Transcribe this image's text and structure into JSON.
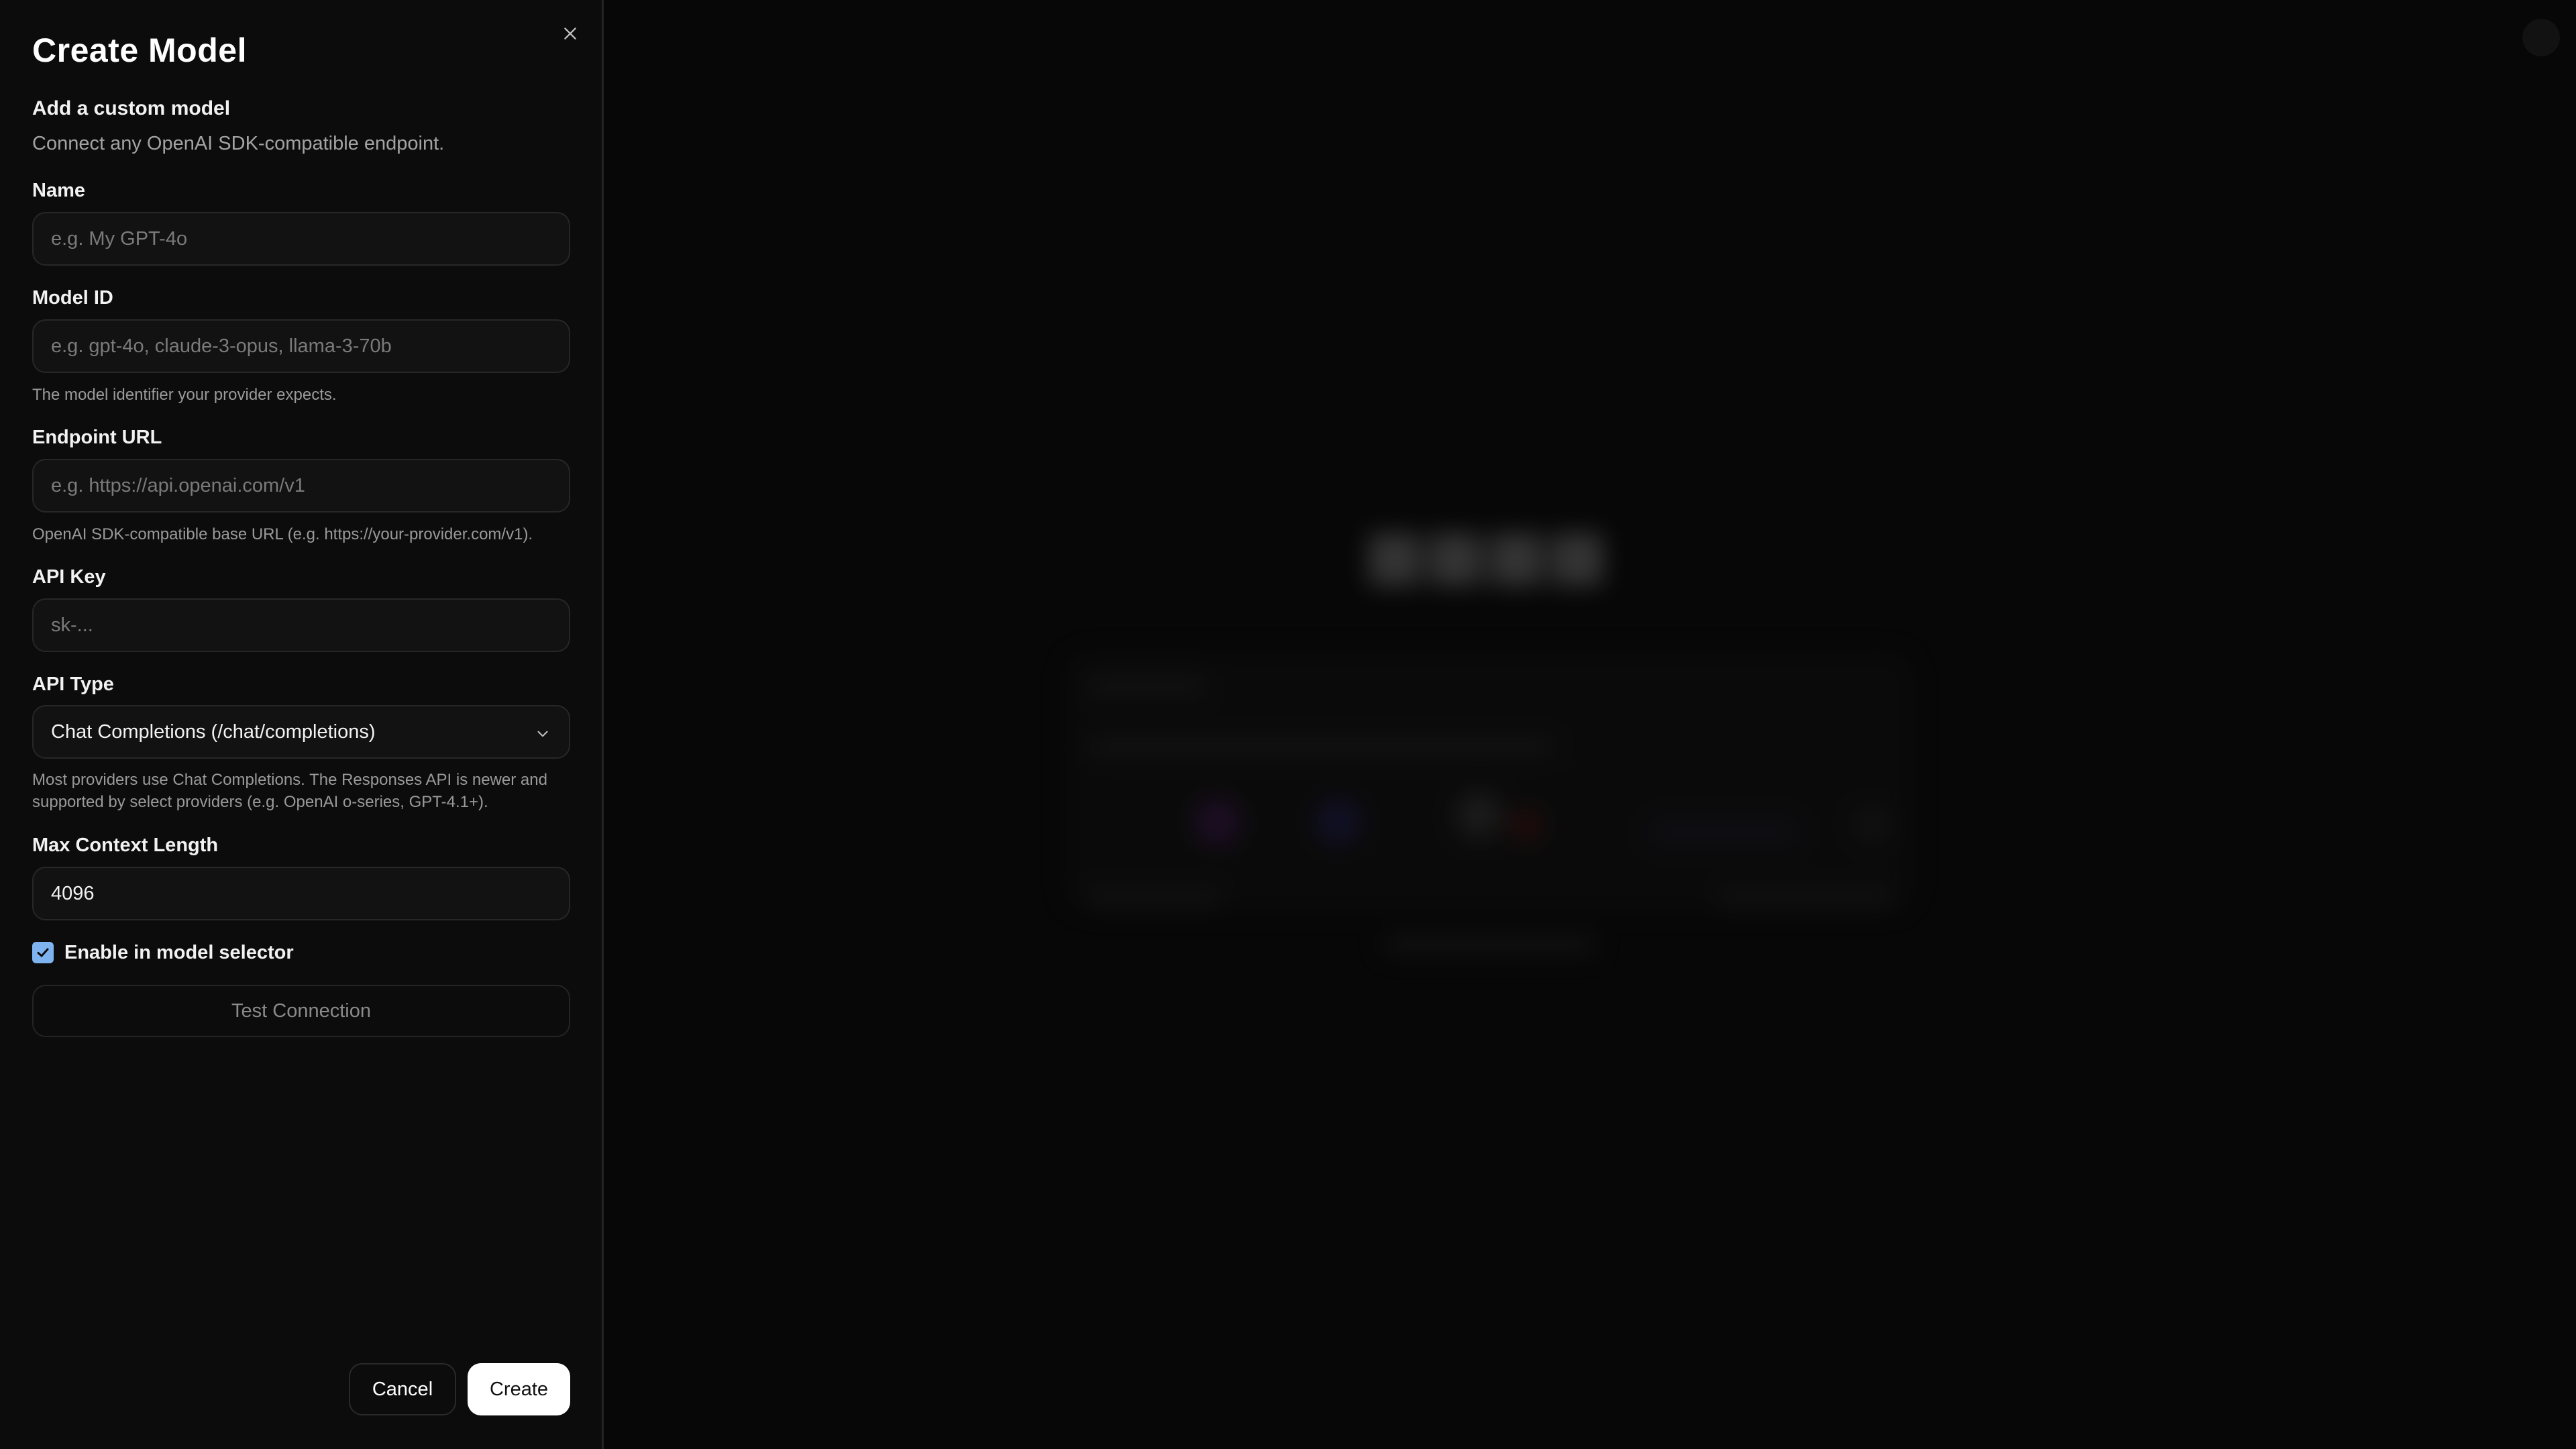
{
  "dialog": {
    "title": "Create Model",
    "subtitle": "Add a custom model",
    "description": "Connect any OpenAI SDK-compatible endpoint."
  },
  "fields": {
    "name": {
      "label": "Name",
      "placeholder": "e.g. My GPT-4o",
      "value": ""
    },
    "model_id": {
      "label": "Model ID",
      "placeholder": "e.g. gpt-4o, claude-3-opus, llama-3-70b",
      "value": "",
      "hint": "The model identifier your provider expects."
    },
    "endpoint_url": {
      "label": "Endpoint URL",
      "placeholder": "e.g. https://api.openai.com/v1",
      "value": "",
      "hint": "OpenAI SDK-compatible base URL (e.g. https://your-provider.com/v1)."
    },
    "api_key": {
      "label": "API Key",
      "placeholder": "sk-...",
      "value": ""
    },
    "api_type": {
      "label": "API Type",
      "selected": "Chat Completions (/chat/completions)",
      "hint": "Most providers use Chat Completions. The Responses API is newer and supported by select providers (e.g. OpenAI o-series, GPT-4.1+)."
    },
    "max_context_length": {
      "label": "Max Context Length",
      "value": "4096"
    }
  },
  "enable_selector": {
    "label": "Enable in model selector",
    "checked": true
  },
  "buttons": {
    "test_connection": "Test Connection",
    "cancel": "Cancel",
    "create": "Create"
  },
  "colors": {
    "accent_checkbox": "#7fb3f0",
    "primary_button": "#ffffff",
    "sheet_background": "#0c0c0c"
  },
  "icons": {
    "close": "close-icon",
    "select": "chevron-down-icon",
    "checkbox": "check-icon"
  }
}
